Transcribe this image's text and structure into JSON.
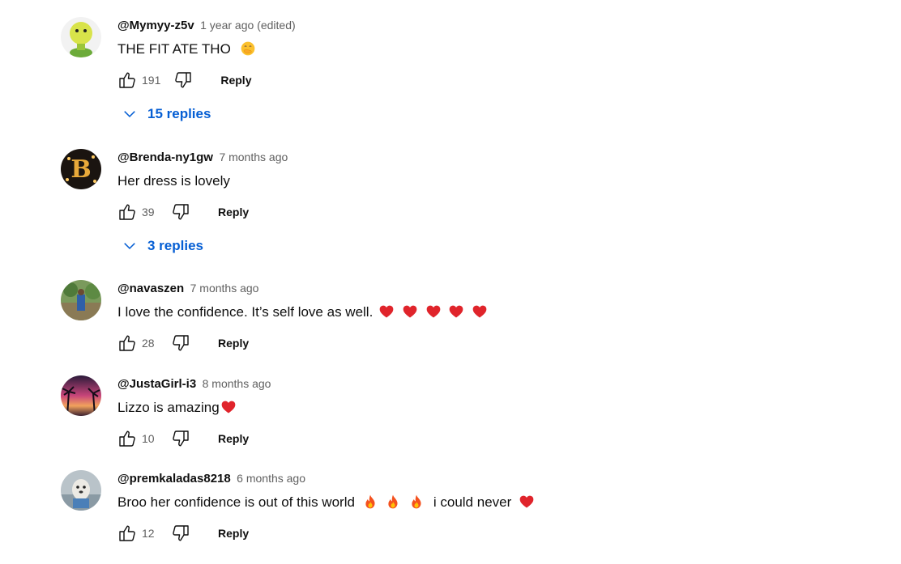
{
  "comments": [
    {
      "author": "@Mymyy-z5v",
      "time": "1 year ago (edited)",
      "text": "THE FIT ATE THO",
      "emoji": [
        "face-with-hand-over-mouth"
      ],
      "likes": "191",
      "reply_label": "Reply",
      "replies_label": "15 replies"
    },
    {
      "author": "@Brenda-ny1gw",
      "time": "7 months ago",
      "text": "Her dress is lovely",
      "likes": "39",
      "reply_label": "Reply",
      "replies_label": "3 replies"
    },
    {
      "author": "@navaszen",
      "time": "7 months ago",
      "text": "I love the confidence. It’s self love as well.",
      "emoji": [
        "red-heart",
        "red-heart",
        "red-heart",
        "red-heart",
        "red-heart"
      ],
      "likes": "28",
      "reply_label": "Reply"
    },
    {
      "author": "@JustaGirl-i3",
      "time": "8 months ago",
      "text": "Lizzo is amazing",
      "emoji": [
        "red-heart"
      ],
      "likes": "10",
      "reply_label": "Reply"
    },
    {
      "author": "@premkaladas8218",
      "time": "6 months ago",
      "text_part1": "Broo her confidence is out of this world",
      "emoji_part1": [
        "fire",
        "fire",
        "fire"
      ],
      "text_part2": "i could never",
      "emoji_part2": [
        "red-heart"
      ],
      "likes": "12",
      "reply_label": "Reply"
    }
  ],
  "icons": {
    "like": "thumb-up-icon",
    "dislike": "thumb-down-icon",
    "expand": "chevron-down-icon"
  },
  "colors": {
    "link_blue": "#065fd4",
    "secondary_text": "#606060",
    "heart_red": "#e0242b"
  }
}
